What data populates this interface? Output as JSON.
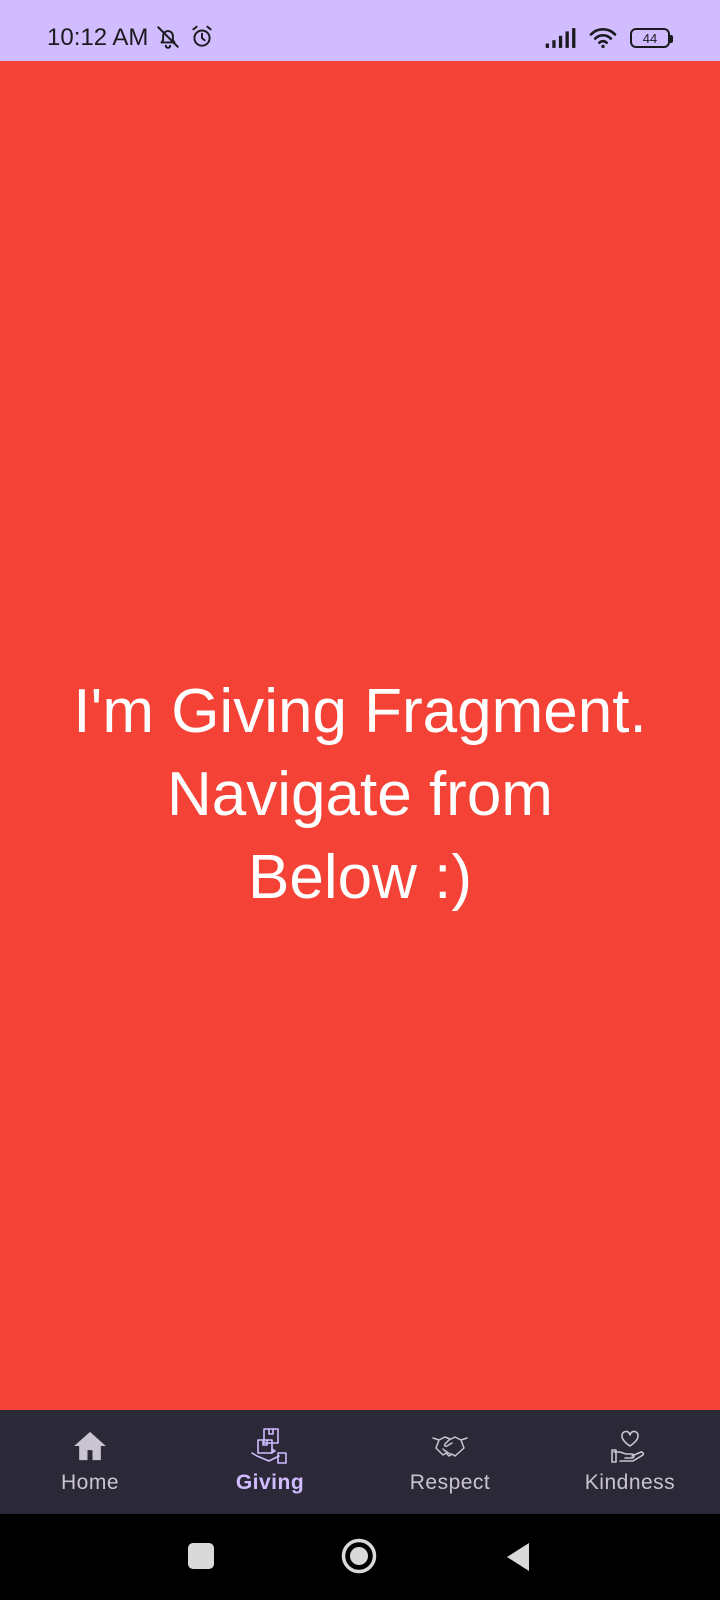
{
  "status_bar": {
    "time": "10:12 AM",
    "left_icons": [
      "bell-off-icon",
      "alarm-icon"
    ],
    "right_icons": [
      "signal-icon",
      "wifi-icon",
      "battery-icon"
    ],
    "battery_level": "44"
  },
  "content": {
    "background_color": "#f44336",
    "message": "I'm Giving Fragment.\nNavigate from\nBelow :)"
  },
  "bottom_nav": {
    "items": [
      {
        "label": "Home",
        "icon": "home-icon",
        "active": false
      },
      {
        "label": "Giving",
        "icon": "giving-box-icon",
        "active": true
      },
      {
        "label": "Respect",
        "icon": "handshake-icon",
        "active": false
      },
      {
        "label": "Kindness",
        "icon": "heart-hand-icon",
        "active": false
      }
    ],
    "active_color": "#d0bcff",
    "inactive_color": "#cac4d0"
  },
  "system_nav": {
    "buttons": [
      "recents-icon",
      "home-circle-icon",
      "back-icon"
    ]
  }
}
